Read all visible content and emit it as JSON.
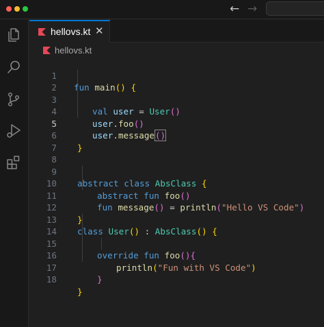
{
  "window": {
    "traffic_lights": [
      "close",
      "minimize",
      "zoom"
    ],
    "nav_back_glyph": "←",
    "nav_forward_glyph": "→"
  },
  "activity_bar": [
    "explorer-icon",
    "search-icon",
    "source-control-icon",
    "run-debug-icon",
    "extensions-icon"
  ],
  "tab": {
    "label": "hellovs.kt",
    "close_glyph": "✕"
  },
  "breadcrumb": {
    "label": "hellovs.kt"
  },
  "editor": {
    "active_line": 5,
    "lines": [
      {
        "n": "1"
      },
      {
        "n": "2"
      },
      {
        "n": "3"
      },
      {
        "n": "4"
      },
      {
        "n": "5"
      },
      {
        "n": "6"
      },
      {
        "n": "7"
      },
      {
        "n": "8"
      },
      {
        "n": "9"
      },
      {
        "n": "10"
      },
      {
        "n": "11"
      },
      {
        "n": "12"
      },
      {
        "n": "13"
      },
      {
        "n": "14"
      },
      {
        "n": "15"
      },
      {
        "n": "16"
      },
      {
        "n": "17"
      },
      {
        "n": "18"
      }
    ],
    "code": {
      "l1": [
        "fun",
        " ",
        "main",
        "(",
        ")",
        " ",
        "{"
      ],
      "l3": [
        "val",
        " ",
        "user",
        " = ",
        "User",
        "(",
        ")"
      ],
      "l4": [
        "user",
        ".",
        "foo",
        "(",
        ")"
      ],
      "l5": [
        "user",
        ".",
        "message",
        "(",
        ")"
      ],
      "l6": [
        "}"
      ],
      "l9": [
        "abstract",
        " ",
        "class",
        " ",
        "AbsClass",
        " ",
        "{"
      ],
      "l10": [
        "abstract",
        " ",
        "fun",
        " ",
        "foo",
        "(",
        ")"
      ],
      "l11": [
        "fun",
        " ",
        "message",
        "(",
        ")",
        " = ",
        "println",
        "(",
        "\"Hello VS Code\"",
        ")"
      ],
      "l12": [
        "}"
      ],
      "l13": [
        "class",
        " ",
        "User",
        "(",
        ")",
        " : ",
        "AbsClass",
        "(",
        ")",
        " ",
        "{"
      ],
      "l15": [
        "override",
        " ",
        "fun",
        " ",
        "foo",
        "(",
        ")",
        "{"
      ],
      "l16": [
        "println",
        "(",
        "\"Fun with VS Code\"",
        ")"
      ],
      "l17": [
        "}"
      ],
      "l18": [
        "}"
      ]
    }
  },
  "colors": {
    "keyword": "#569cd6",
    "function": "#dcdcaa",
    "type": "#4ec9b0",
    "variable": "#9cdcfe",
    "string": "#ce9178",
    "bracket_level1": "#ffd700",
    "bracket_level2": "#da70d6",
    "accent": "#0078d4"
  }
}
